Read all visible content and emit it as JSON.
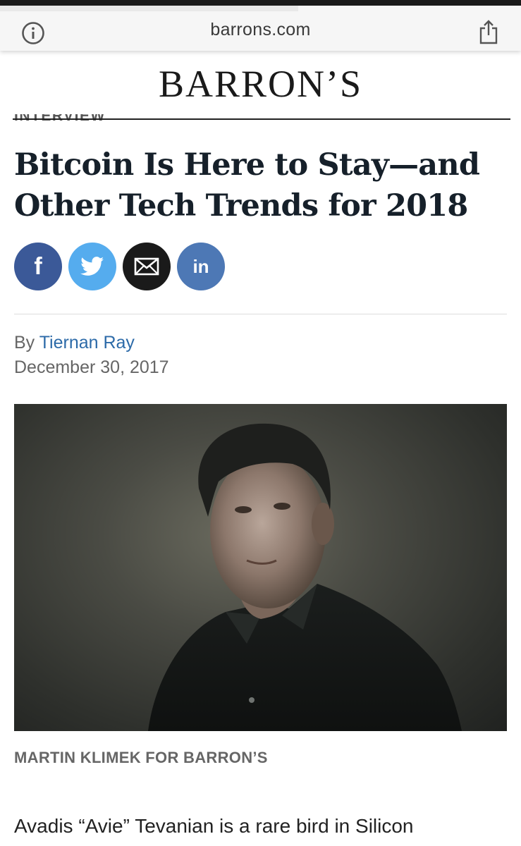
{
  "browser": {
    "url": "barrons.com",
    "info_icon": "info-icon",
    "share_icon": "share-icon"
  },
  "masthead": {
    "logo": "BARRON’S"
  },
  "article": {
    "kicker": "INTERVIEW",
    "headline": "Bitcoin Is Here to Stay—and Other Tech Trends for 2018",
    "social": [
      {
        "name": "facebook",
        "icon": "facebook-icon",
        "glyph": "f",
        "color": "#3b5998"
      },
      {
        "name": "twitter",
        "icon": "twitter-icon",
        "color": "#55acee"
      },
      {
        "name": "email",
        "icon": "email-icon",
        "color": "#1a1a1a"
      },
      {
        "name": "linkedin",
        "icon": "linkedin-icon",
        "glyph": "in",
        "color": "#4d78b5"
      }
    ],
    "byline_prefix": "By",
    "author": "Tiernan Ray",
    "date": "December 30, 2017",
    "photo_credit": "MARTIN KLIMEK FOR BARRON’S",
    "body_first_line": "Avadis “Avie” Tevanian is a rare bird in Silicon"
  }
}
